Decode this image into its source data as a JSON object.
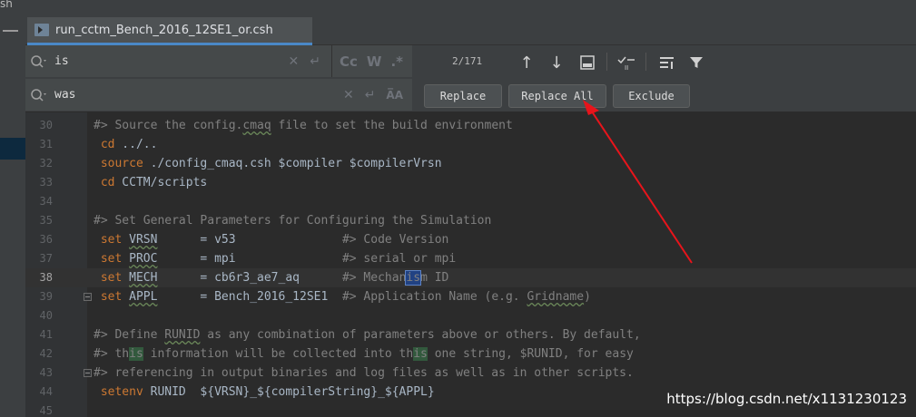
{
  "window": {
    "top_left_text": "sh"
  },
  "tab": {
    "label": "run_cctm_Bench_2016_12SE1_or.csh"
  },
  "find": {
    "search_value": "is",
    "replace_value": "was",
    "match_count": "2/171",
    "case_option": "Cc",
    "word_option": "W",
    "regex_option": ".*",
    "preserve_case_option": "A̅A",
    "buttons": {
      "replace": "Replace",
      "replace_all": "Replace All",
      "exclude": "Exclude"
    }
  },
  "editor": {
    "lines": [
      {
        "num": "30",
        "text": "#> Source the config.cmaq file to set the build environment"
      },
      {
        "num": "31",
        "text": " cd ../.."
      },
      {
        "num": "32",
        "text": " source ./config_cmaq.csh $compiler $compilerVrsn"
      },
      {
        "num": "33",
        "text": " cd CCTM/scripts"
      },
      {
        "num": "34",
        "text": ""
      },
      {
        "num": "35",
        "text": "#> Set General Parameters for Configuring the Simulation"
      },
      {
        "num": "36",
        "text": " set VRSN      = v53               #> Code Version"
      },
      {
        "num": "37",
        "text": " set PROC      = mpi               #> serial or mpi"
      },
      {
        "num": "38",
        "text": " set MECH      = cb6r3_ae7_aq      #> Mechanism ID"
      },
      {
        "num": "39",
        "text": " set APPL      = Bench_2016_12SE1  #> Application Name (e.g. Gridname)"
      },
      {
        "num": "40",
        "text": ""
      },
      {
        "num": "41",
        "text": "#> Define RUNID as any combination of parameters above or others. By default,"
      },
      {
        "num": "42",
        "text": "#> this information will be collected into this one string, $RUNID, for easy"
      },
      {
        "num": "43",
        "text": "#> referencing in output binaries and log files as well as in other scripts."
      },
      {
        "num": "44",
        "text": " setenv RUNID  ${VRSN}_${compilerString}_${APPL}"
      },
      {
        "num": "45",
        "text": ""
      }
    ]
  },
  "watermark": "https://blog.csdn.net/x1131230123",
  "colors": {
    "background": "#2b2b2b",
    "keyword": "#cc7832",
    "comment": "#808080",
    "match_highlight": "#32593d",
    "annotation_arrow": "#e8141b"
  }
}
